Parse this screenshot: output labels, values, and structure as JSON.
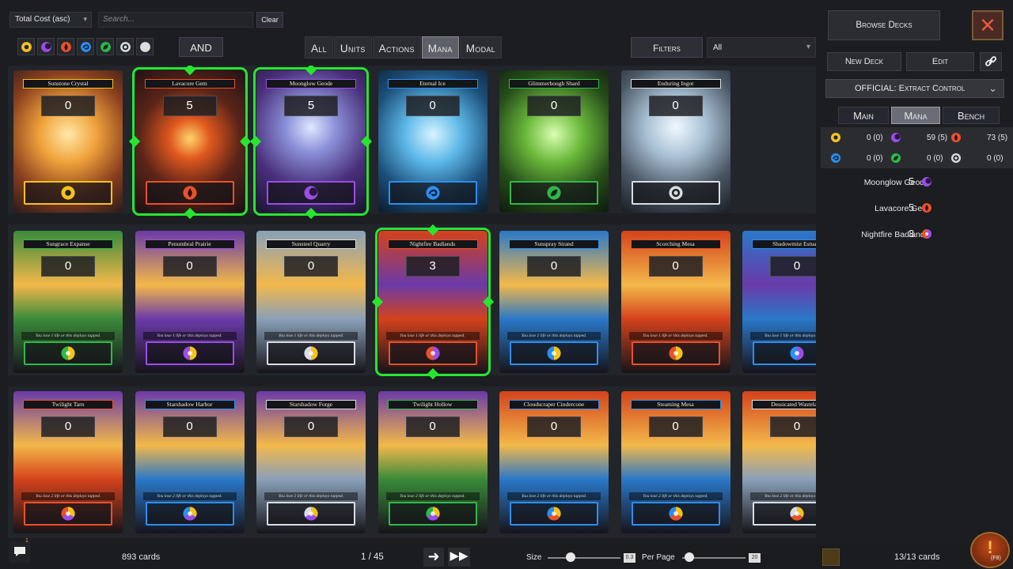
{
  "toolbar": {
    "sort": "Total Cost (asc)",
    "search_placeholder": "Search...",
    "clear": "Clear",
    "and_label": "AND",
    "mana_filters": [
      "sun",
      "moon",
      "fire",
      "water",
      "leaf",
      "void",
      "colorless"
    ],
    "type_tabs": [
      "All",
      "Units",
      "Actions",
      "Mana",
      "Modal"
    ],
    "active_type_tab": "Mana",
    "filters": "Filters",
    "filter_value": "All"
  },
  "colors": {
    "sun": "#f4c21d",
    "moon": "#9b4de8",
    "fire": "#e8512a",
    "water": "#2b8ef0",
    "leaf": "#2fb84a",
    "void": "#d8dde3",
    "selected": "#27e62f"
  },
  "rows": [
    {
      "cards": [
        {
          "name": "Sunstone Crystal",
          "cost": "0",
          "element": "sun",
          "selected": false
        },
        {
          "name": "Lavacore Gem",
          "cost": "5",
          "element": "fire",
          "selected": true
        },
        {
          "name": "Moonglow Geode",
          "cost": "5",
          "element": "moon",
          "selected": true
        },
        {
          "name": "Eternal Ice",
          "cost": "0",
          "element": "water",
          "selected": false
        },
        {
          "name": "Glimmerbough Shard",
          "cost": "0",
          "element": "leaf",
          "selected": false
        },
        {
          "name": "Enduring Ingot",
          "cost": "0",
          "element": "void",
          "selected": false
        }
      ]
    },
    {
      "cards": [
        {
          "name": "Sungrace Expanse",
          "cost": "0",
          "element": "sun-leaf",
          "selected": false,
          "rule": "You lose 1 life or this deploys tapped."
        },
        {
          "name": "Penumbral Prairie",
          "cost": "0",
          "element": "sun-moon",
          "selected": false,
          "rule": "You lose 1 life or this deploys tapped."
        },
        {
          "name": "Sunsteel Quarry",
          "cost": "0",
          "element": "sun-void",
          "selected": false,
          "rule": "You lose 1 life or this deploys tapped."
        },
        {
          "name": "Nightfire Badlands",
          "cost": "3",
          "element": "moon-fire",
          "selected": true,
          "rule": "You lose 1 life or this deploys tapped."
        },
        {
          "name": "Sunspray Strand",
          "cost": "0",
          "element": "sun-water",
          "selected": false,
          "rule": "You lose 1 life or this deploys tapped."
        },
        {
          "name": "Scorching Mesa",
          "cost": "0",
          "element": "sun-fire",
          "selected": false,
          "rule": "You lose 1 life or this deploys tapped."
        },
        {
          "name": "Shadowmist Estuary",
          "cost": "0",
          "element": "moon-water",
          "selected": false,
          "rule": "You lose 1 life or this deploys tapped."
        }
      ]
    },
    {
      "cards": [
        {
          "name": "Twilight Tarn",
          "cost": "0",
          "element": "sun-moon-fire",
          "selected": false,
          "rule": "You lose 2 life or this deploys tapped."
        },
        {
          "name": "Starshadow Harbor",
          "cost": "0",
          "element": "sun-moon-water",
          "selected": false,
          "rule": "You lose 2 life or this deploys tapped."
        },
        {
          "name": "Starshadow Forge",
          "cost": "0",
          "element": "sun-moon-void",
          "selected": false,
          "rule": "You lose 2 life or this deploys tapped."
        },
        {
          "name": "Twilight Hollow",
          "cost": "0",
          "element": "sun-moon-leaf",
          "selected": false,
          "rule": "You lose 2 life or this deploys tapped."
        },
        {
          "name": "Cloudscraper Cindercone",
          "cost": "0",
          "element": "sun-fire-water",
          "selected": false,
          "rule": "You lose 2 life or this deploys tapped."
        },
        {
          "name": "Steaming Mesa",
          "cost": "0",
          "element": "sun-fire-water",
          "selected": false,
          "rule": "You lose 2 life or this deploys tapped."
        },
        {
          "name": "Dessicated Wasteland",
          "cost": "0",
          "element": "sun-fire-void",
          "selected": false,
          "rule": "You lose 2 life or this deploys tapped."
        }
      ]
    }
  ],
  "panel": {
    "browse": "Browse Decks",
    "new_deck": "New Deck",
    "edit": "Edit",
    "deck_name": "OFFICIAL: Extract Control",
    "tabs": [
      "Main",
      "Mana",
      "Bench"
    ],
    "active_tab": "Mana",
    "mana_counts": [
      {
        "element": "sun",
        "text": "0 (0)"
      },
      {
        "element": "moon",
        "text": "59 (5)"
      },
      {
        "element": "fire",
        "text": "73 (5)"
      },
      {
        "element": "water",
        "text": "0 (0)"
      },
      {
        "element": "leaf",
        "text": "0 (0)"
      },
      {
        "element": "void",
        "text": "0 (0)"
      }
    ],
    "deck_cards": [
      {
        "name": "Moonglow Geode",
        "count": "5",
        "element": "moon"
      },
      {
        "name": "Lavacore Gem",
        "count": "5",
        "element": "fire"
      },
      {
        "name": "Nightfire Badlands",
        "count": "3",
        "element": "moon-fire"
      }
    ]
  },
  "bottom": {
    "chat_badge": "1",
    "card_count": "893 cards",
    "page": "1 / 45",
    "size_label": "Size",
    "size_value": "0.3",
    "size_fraction": 0.31,
    "perpage_label": "Per Page",
    "perpage_value": "20",
    "perpage_fraction": 0.04,
    "deck_count": "13/13 cards",
    "alert_key": "(F8)"
  }
}
